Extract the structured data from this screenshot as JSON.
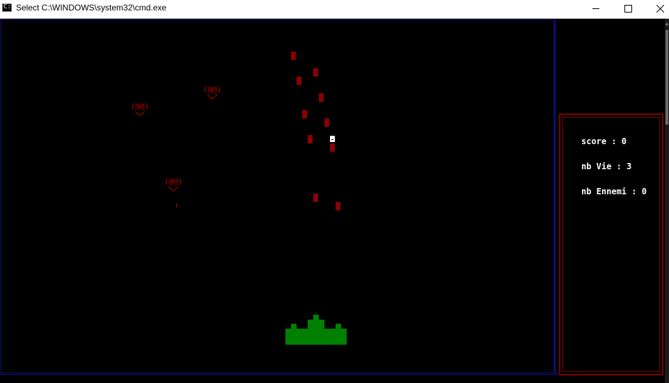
{
  "window": {
    "title": "Select C:\\WINDOWS\\system32\\cmd.exe",
    "icon": "cmd-icon",
    "icon_glyph": "C:\\",
    "controls": [
      "minimize-icon",
      "maximize-icon",
      "close-icon"
    ]
  },
  "hud": {
    "score_line": "score : 0",
    "lives_line": "nb Vie : 3",
    "enemies_line": "nb Ennemi : 0"
  },
  "game": {
    "enemy_glyph": "(@@)",
    "enemy_shot_glyph": "!",
    "colors": {
      "enemy": "#c00000",
      "bullet": "#8b0000",
      "player": "#008000",
      "hud_border": "#800000",
      "field_border": "#101080",
      "projectile": "#ffffff"
    }
  }
}
